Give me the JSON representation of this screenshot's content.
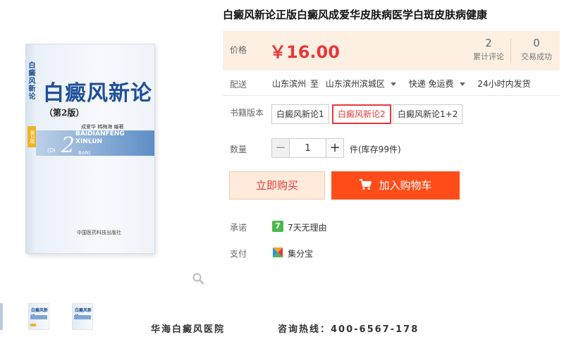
{
  "book": {
    "cover_title": "白癜风新论",
    "cover_edition": "（第2版）",
    "spine_title": "白癜风新论",
    "spine_edition": "第2版",
    "authors": "成爱华  韩梅海  编著",
    "pinyin_line1": "BAIDIANFENG",
    "pinyin_line2": "XINLUN",
    "pinyin_di": "(DI",
    "pinyin_num": "2",
    "pinyin_ban": "BAN)",
    "publisher": "中国医药科技出版社"
  },
  "thumbnails": [
    {
      "title": "白癜风新论"
    },
    {
      "title": "白癜风新论"
    }
  ],
  "banner": {
    "hospital": "华海白癜风医院",
    "hotline": "咨询热线：400-6567-178"
  },
  "product": {
    "title": "白癜风新论正版白癜风成爱华皮肤病医学白斑皮肤病健康",
    "price_label": "价格",
    "price": "￥16.00",
    "stats": [
      {
        "num": "2",
        "label": "累计评论"
      },
      {
        "num": "0",
        "label": "交易成功"
      }
    ]
  },
  "delivery": {
    "label": "配送",
    "from": "山东滨州",
    "to_word": "至",
    "to": "山东滨州滨城区",
    "shipping": "快递 免运费",
    "dispatch": "24小时内发货"
  },
  "versions": {
    "label": "书籍版本",
    "options": [
      "白癜风新论1",
      "白癜风新论2",
      "白癜风新论1+2"
    ],
    "selected": "白癜风新论2"
  },
  "quantity": {
    "label": "数量",
    "minus": "−",
    "plus": "+",
    "value": "1",
    "stock": "件(库存99件)"
  },
  "actions": {
    "buy_now": "立即购买",
    "add_cart": "加入购物车"
  },
  "promise": {
    "label": "承诺",
    "icon_text": "7",
    "text": "7天无理由"
  },
  "payment": {
    "label": "支付",
    "text": "集分宝"
  },
  "colors": {
    "accent": "#e4393c",
    "cart_button": "#ff4d1a",
    "price_bg": "#fdefe2",
    "promise_green": "#4cb84c"
  },
  "icons": [
    "zoom-icon",
    "cart-icon",
    "jifenbao-icon",
    "seven-day-icon"
  ]
}
